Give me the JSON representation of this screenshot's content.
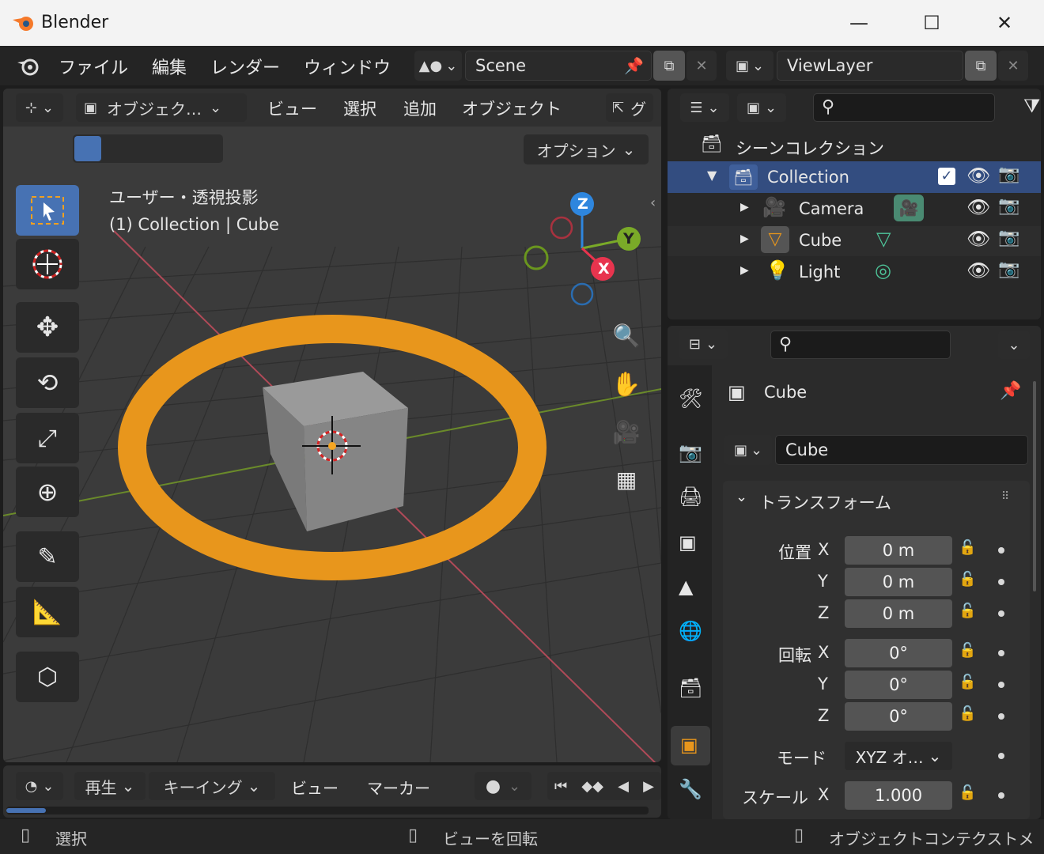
{
  "window": {
    "title": "Blender",
    "minimize": "—",
    "maximize": "☐",
    "close": "✕"
  },
  "menu": {
    "items": [
      "ファイル",
      "編集",
      "レンダー",
      "ウィンドウ"
    ],
    "scene": "Scene",
    "view_layer": "ViewLayer"
  },
  "viewport": {
    "mode": "オブジェク…",
    "menus": [
      "ビュー",
      "選択",
      "追加",
      "オブジェクト"
    ],
    "partial_menu": "グ",
    "options_label": "オプション",
    "info_line1": "ユーザー・透視投影",
    "info_line2": "(1) Collection | Cube",
    "gizmo": {
      "x": "X",
      "y": "Y",
      "z": "Z"
    }
  },
  "outliner": {
    "search_placeholder": "",
    "scene_collection": "シーンコレクション",
    "collection": "Collection",
    "items": [
      {
        "name": "Camera",
        "icon": "camera-icon"
      },
      {
        "name": "Cube",
        "icon": "mesh-icon"
      },
      {
        "name": "Light",
        "icon": "light-icon"
      }
    ]
  },
  "properties": {
    "object_name": "Cube",
    "datablock_name": "Cube",
    "panel_title": "トランスフォーム",
    "location_label": "位置",
    "rotation_label": "回転",
    "scale_label": "スケール",
    "mode_label": "モード",
    "axis": {
      "x": "X",
      "y": "Y",
      "z": "Z"
    },
    "location": [
      "0 m",
      "0 m",
      "0 m"
    ],
    "rotation": [
      "0°",
      "0°",
      "0°"
    ],
    "rotation_mode": "XYZ オ…",
    "scale_x": "1.000"
  },
  "timeline": {
    "play": "再生",
    "keying": "キーイング",
    "view": "ビュー",
    "marker": "マーカー"
  },
  "status": {
    "select": "選択",
    "rotate_view": "ビューを回転",
    "context": "オブジェクトコンテクストメ"
  },
  "colors": {
    "accent": "#4772b3",
    "selection_orange": "#e8961c",
    "x_axis": "#e8344e",
    "y_axis": "#7aaa28",
    "z_axis": "#2e86de"
  }
}
